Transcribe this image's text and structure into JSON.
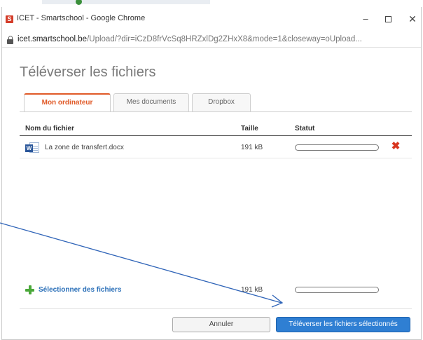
{
  "window": {
    "favicon_letter": "S",
    "title": "ICET - Smartschool - Google Chrome",
    "minimize": "–",
    "close": "✕"
  },
  "address": {
    "host": "icet.smartschool.be",
    "path": "/Upload/?dir=iCzD8frVcSq8HRZxlDg2ZHxX8&mode=1&closeway=oUpload..."
  },
  "upload": {
    "title": "Téléverser les fichiers",
    "tabs": [
      {
        "label": "Mon ordinateur",
        "active": true
      },
      {
        "label": "Mes documents",
        "active": false
      },
      {
        "label": "Dropbox",
        "active": false
      }
    ],
    "columns": {
      "name": "Nom du fichier",
      "size": "Taille",
      "status": "Statut"
    },
    "files": [
      {
        "icon": "word-document-icon",
        "name": "La zone de transfert.docx",
        "size": "191 kB",
        "progress": 0
      }
    ],
    "select_label": "Sélectionner des fichiers",
    "total_size": "191 kB",
    "total_progress": 0,
    "cancel_label": "Annuler",
    "submit_label": "Téléverser les fichiers sélectionnés"
  },
  "colors": {
    "accent_tab": "#e05a28",
    "primary_button": "#2f7fd3",
    "link": "#2a6fb8",
    "remove": "#d8361f",
    "plus": "#4aa83a",
    "annotation_arrow": "#2f64b8"
  }
}
